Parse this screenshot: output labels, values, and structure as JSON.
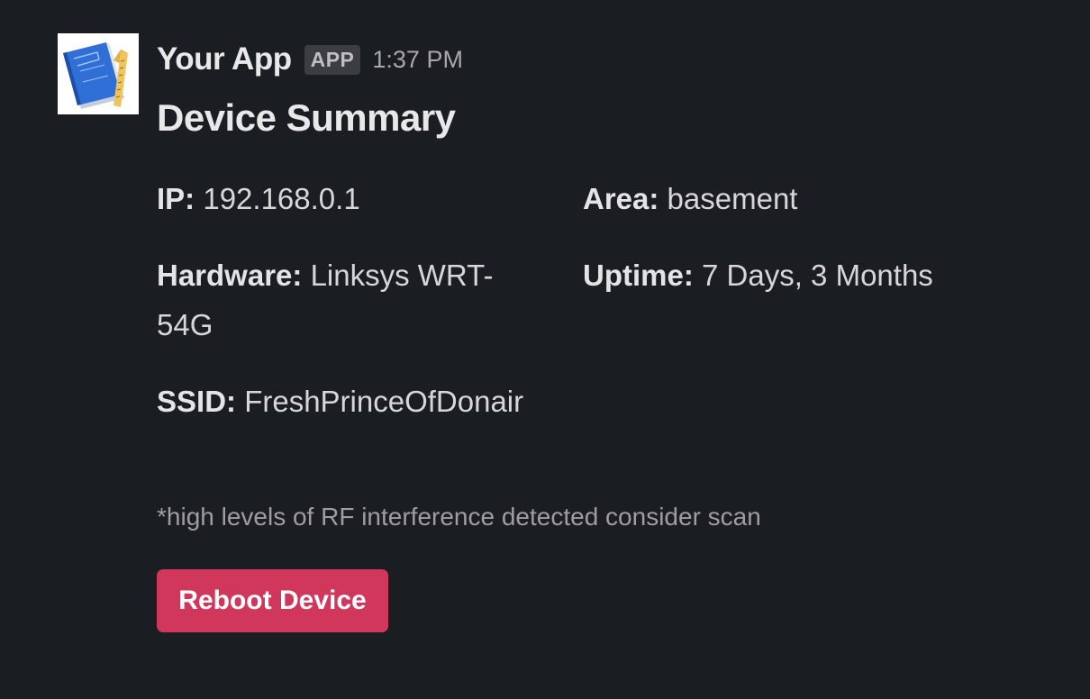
{
  "message": {
    "app_name": "Your App",
    "app_badge": "APP",
    "timestamp": "1:37 PM",
    "avatar_icon": "blueprint-ruler-icon"
  },
  "block": {
    "title": "Device Summary",
    "fields": {
      "ip": {
        "label": "IP:",
        "value": "192.168.0.1"
      },
      "area": {
        "label": "Area:",
        "value": "basement"
      },
      "hardware": {
        "label": "Hardware:",
        "value": "Linksys WRT-54G"
      },
      "uptime": {
        "label": "Uptime:",
        "value": "7 Days, 3 Months"
      },
      "ssid": {
        "label": "SSID:",
        "value": "FreshPrinceOfDonair"
      }
    },
    "context_note": "*high levels of RF interference detected consider scan",
    "action_button": {
      "label": "Reboot Device",
      "color": "#d0375b"
    }
  },
  "theme": {
    "background": "#1a1d21",
    "text": "#d1d2d3"
  }
}
